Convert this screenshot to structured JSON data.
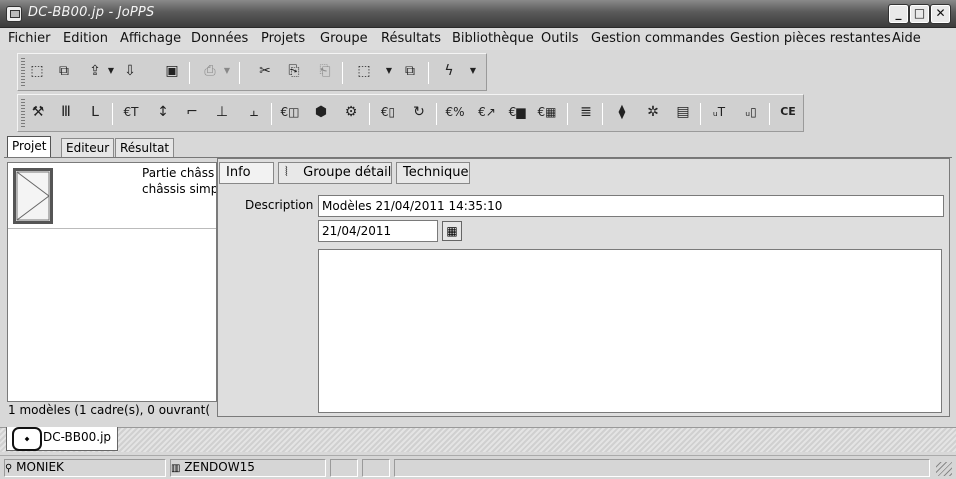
{
  "window": {
    "title": "DC-BB00.jp - JoPPS"
  },
  "menu": [
    "Fichier",
    "Edition",
    "Affichage",
    "Données",
    "Projets",
    "Groupe",
    "Résultats",
    "Bibliothèque",
    "Outils",
    "Gestion commandes",
    "Gestion pièces restantes",
    "Aide"
  ],
  "toolbar1": {
    "icons": [
      {
        "name": "new-icon",
        "glyph": "⬚"
      },
      {
        "name": "copy-icon",
        "glyph": "⧉"
      },
      {
        "name": "open-icon",
        "glyph": "⇪"
      },
      {
        "name": "import-icon",
        "glyph": "⇩"
      },
      {
        "name": "save-icon",
        "glyph": "▣"
      },
      {
        "name": "print-icon",
        "glyph": "⎙"
      },
      {
        "name": "cut-icon",
        "glyph": "✂"
      },
      {
        "name": "paste-icon",
        "glyph": "⎘"
      },
      {
        "name": "paste-special-icon",
        "glyph": "⎗"
      },
      {
        "name": "select-icon",
        "glyph": "⬚"
      },
      {
        "name": "windows-icon",
        "glyph": "⧉"
      },
      {
        "name": "lightning-icon",
        "glyph": "ϟ"
      }
    ]
  },
  "toolbar2": {
    "icons": [
      {
        "name": "wrench-icon",
        "glyph": "⚒"
      },
      {
        "name": "profile-icon",
        "glyph": "Ⅲ"
      },
      {
        "name": "l-profile-icon",
        "glyph": "ꓡ"
      },
      {
        "name": "euro-profile-icon",
        "glyph": "€ꓔ"
      },
      {
        "name": "dimension-icon",
        "glyph": "↕"
      },
      {
        "name": "corner-icon",
        "glyph": "⌐"
      },
      {
        "name": "assembly-icon",
        "glyph": "⊥"
      },
      {
        "name": "beam-icon",
        "glyph": "⫠"
      },
      {
        "name": "euro-glazing-icon",
        "glyph": "€◫"
      },
      {
        "name": "box-icon",
        "glyph": "⬢"
      },
      {
        "name": "gears-icon",
        "glyph": "⚙"
      },
      {
        "name": "euro-panel-icon",
        "glyph": "€▯"
      },
      {
        "name": "rotate-icon",
        "glyph": "↻"
      },
      {
        "name": "euro-percent-icon",
        "glyph": "€%"
      },
      {
        "name": "euro-chart-icon",
        "glyph": "€↗"
      },
      {
        "name": "euro-bar-icon",
        "glyph": "€▆"
      },
      {
        "name": "euro-table-icon",
        "glyph": "€▦"
      },
      {
        "name": "list-icon",
        "glyph": "≣"
      },
      {
        "name": "weld-icon",
        "glyph": "⧫"
      },
      {
        "name": "cog-icon",
        "glyph": "✲"
      },
      {
        "name": "stack-icon",
        "glyph": "▤"
      },
      {
        "name": "u-profile-icon",
        "glyph": "ᵤꓔ"
      },
      {
        "name": "u-panel-icon",
        "glyph": "ᵤ▯"
      },
      {
        "name": "ce-mark-icon",
        "glyph": "CE"
      }
    ]
  },
  "tabs": [
    {
      "label": "Projet",
      "active": true
    },
    {
      "label": "Editeur",
      "active": false
    },
    {
      "label": "Résultat",
      "active": false
    }
  ],
  "project": {
    "item_text_line1": "Partie châss",
    "item_text_line2": "châssis simp",
    "footer": "1 modèles (1 cadre(s), 0 ouvrant("
  },
  "detail": {
    "subtabs": [
      {
        "label": "Info",
        "active": true
      },
      {
        "label": "Groupe détail",
        "active": false,
        "icon": "paperclip-icon"
      },
      {
        "label": "Technique",
        "active": false
      }
    ],
    "description_label": "Description",
    "description_value": "Modèles 21/04/2011 14:35:10",
    "date_value": "21/04/2011",
    "notes": ""
  },
  "document_tab": {
    "label": "DC-BB00.jp"
  },
  "status": {
    "user": "MONIEK",
    "database": "ZENDOW15"
  }
}
